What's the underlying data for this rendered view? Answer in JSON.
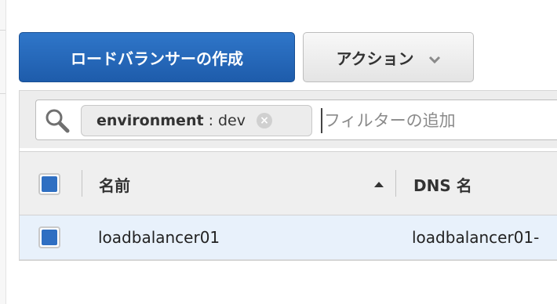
{
  "toolbar": {
    "create_label": "ロードバランサーの作成",
    "actions_label": "アクション"
  },
  "filter": {
    "token_key": "environment",
    "token_separator": ":",
    "token_value": "dev",
    "token_remove_symbol": "×",
    "placeholder": "フィルターの追加",
    "value": ""
  },
  "table": {
    "columns": [
      {
        "label": "名前",
        "sort": "ascending"
      },
      {
        "label": "DNS 名"
      }
    ],
    "rows": [
      {
        "name": "loadbalancer01",
        "dns_name": "loadbalancer01-"
      }
    ]
  },
  "colors": {
    "primary_button": "#2f76c9",
    "checkbox_fill": "#2f6fc2",
    "selected_row": "#e8f1fb",
    "header_bg": "#efefef",
    "filter_bar_bg": "#ededed"
  },
  "icons": {
    "search": "search-icon",
    "actions_dropdown": "chevron-down-icon",
    "token_remove": "clear-circle-icon",
    "sort": "sort-ascending-icon"
  }
}
